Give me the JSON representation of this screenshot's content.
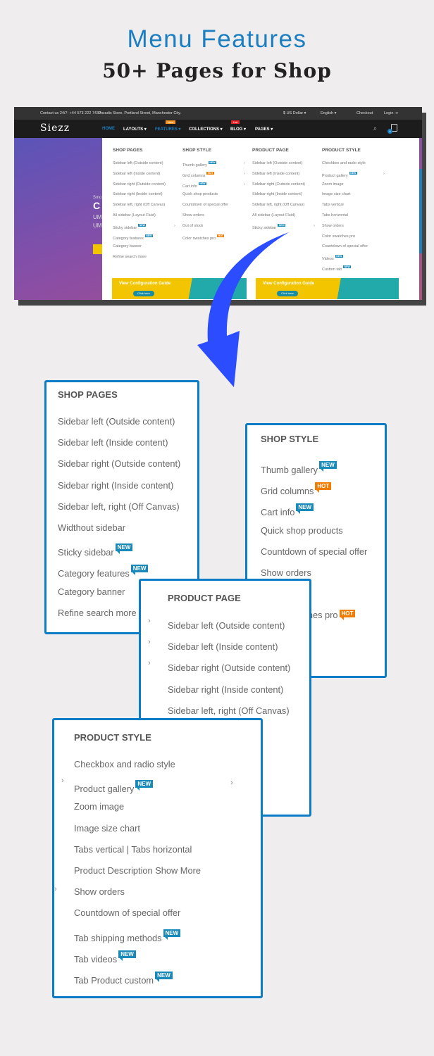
{
  "header": {
    "title": "Menu Features",
    "subtitle": "50+ Pages for Shop"
  },
  "screenshot": {
    "topbar": {
      "contact": "Contact us 24/7: +44 573 222 7439",
      "address": "Paradis Store, Portland Street, Manchester City.",
      "currency": "$ US Dollar ▾",
      "language": "English ▾",
      "checkout": "Checkout",
      "login": "Login ⇥"
    },
    "logo": "Siezz",
    "nav": [
      {
        "label": "HOME",
        "active": true
      },
      {
        "label": "LAYOUTS ▾"
      },
      {
        "label": "FEATURES ▾",
        "badge": "New",
        "active": true
      },
      {
        "label": "COLLECTIONS ▾"
      },
      {
        "label": "BLOG ▾",
        "badge": "Hot"
      },
      {
        "label": "PAGES ▾"
      }
    ],
    "cart_count": "0",
    "hero": {
      "small": "Smo",
      "big": "C",
      "line1": "UM",
      "line2": "UM"
    },
    "mega": {
      "columns": [
        {
          "title": "SHOP PAGES",
          "items": [
            {
              "t": "Sidebar left (Outside content)"
            },
            {
              "t": "Sidebar left (Inside content)"
            },
            {
              "t": "Sidebar right (Outside content)"
            },
            {
              "t": "Sidebar right (Inside content)"
            },
            {
              "t": "Sidebar left, right (Off Canvas)"
            },
            {
              "t": "All sidebar (Layout Fluid)"
            },
            {
              "t": "Sticky sidebar",
              "b": "NEW",
              "arrow": true
            },
            {
              "t": "Category features",
              "b": "NEW"
            },
            {
              "t": "Category banner"
            },
            {
              "t": "Refine search more"
            }
          ]
        },
        {
          "title": "SHOP STYLE",
          "items": [
            {
              "t": "Thumb gallery",
              "b": "NEW",
              "arrow": true
            },
            {
              "t": "Grid columns",
              "b": "HOT",
              "arrow": true
            },
            {
              "t": "Cart info",
              "b": "NEW",
              "arrow": true
            },
            {
              "t": "Quick shop products"
            },
            {
              "t": "Countdown of special offer"
            },
            {
              "t": "Show orders"
            },
            {
              "t": "Out of stock"
            },
            {
              "t": "Color swatches pro",
              "b": "HOT"
            }
          ]
        },
        {
          "title": "PRODUCT PAGE",
          "items": [
            {
              "t": "Sidebar left (Outside content)"
            },
            {
              "t": "Sidebar left (Inside content)"
            },
            {
              "t": "Sidebar right (Outside content)"
            },
            {
              "t": "Sidebar right (Inside content)"
            },
            {
              "t": "Sidebar left, right (Off Canvas)"
            },
            {
              "t": "All sidebar (Layout Fluid)"
            },
            {
              "t": "Sticky sidebar",
              "b": "NEW",
              "arrow": true
            }
          ]
        },
        {
          "title": "PRODUCT STYLE",
          "items": [
            {
              "t": "Checkbox and radio style"
            },
            {
              "t": "Product gallery",
              "b": "NEW",
              "arrow": true
            },
            {
              "t": "Zoom image"
            },
            {
              "t": "Image size chart"
            },
            {
              "t": "Tabs vertical"
            },
            {
              "t": "Tabs horizontal"
            },
            {
              "t": "Show orders"
            },
            {
              "t": "Color swatches pro"
            },
            {
              "t": "Countdown of special offer"
            },
            {
              "t": "Videos",
              "b": "NEW"
            },
            {
              "t": "Custom tab",
              "b": "NEW"
            }
          ]
        }
      ],
      "banners": [
        {
          "title": "View Configuration Guide",
          "button": "Click here"
        },
        {
          "title": "View Configuration Guide",
          "button": "Click here"
        }
      ]
    }
  },
  "cards": {
    "shop_pages": {
      "title": "SHOP PAGES",
      "items": [
        {
          "t": "Sidebar left (Outside content)"
        },
        {
          "t": "Sidebar left (Inside content)"
        },
        {
          "t": "Sidebar right (Outside content)"
        },
        {
          "t": "Sidebar right (Inside content)"
        },
        {
          "t": "Sidebar left, right (Off Canvas)"
        },
        {
          "t": "Widthout sidebar"
        },
        {
          "t": "Sticky sidebar",
          "b": "NEW"
        },
        {
          "t": "Category features",
          "b": "NEW"
        },
        {
          "t": "Category banner"
        },
        {
          "t": "Refine search more"
        }
      ]
    },
    "shop_style": {
      "title": "SHOP STYLE",
      "items": [
        {
          "t": "Thumb gallery",
          "b": "NEW"
        },
        {
          "t": "Grid columns",
          "b": "HOT"
        },
        {
          "t": "Cart info",
          "b": "NEW"
        },
        {
          "t": "Quick shop products"
        },
        {
          "t": "Countdown of special offer"
        },
        {
          "t": "Show orders"
        },
        {
          "t": ""
        },
        {
          "t": "Color swatches pro",
          "b": "HOT"
        }
      ]
    },
    "product_page": {
      "title": "PRODUCT PAGE",
      "items": [
        {
          "t": "Sidebar left (Outside content)"
        },
        {
          "t": "Sidebar left (Inside content)"
        },
        {
          "t": "Sidebar right (Outside content)"
        },
        {
          "t": "Sidebar right (Inside content)"
        },
        {
          "t": "Sidebar left, right (Off Canvas)"
        }
      ]
    },
    "product_style": {
      "title": "PRODUCT STYLE",
      "items": [
        {
          "t": "Checkbox and radio style"
        },
        {
          "t": "Product gallery",
          "b": "NEW"
        },
        {
          "t": "Zoom image"
        },
        {
          "t": "Image size chart"
        },
        {
          "t": "Tabs vertical | Tabs horizontal"
        },
        {
          "t": "Product Description Show More"
        },
        {
          "t": "Show orders"
        },
        {
          "t": "Countdown of special offer"
        },
        {
          "t": "Tab shipping methods",
          "b": "NEW"
        },
        {
          "t": "Tab videos",
          "b": "NEW"
        },
        {
          "t": "Tab Product custom",
          "b": "NEW"
        }
      ]
    }
  },
  "colors": {
    "accent": "#1a7fc1",
    "card_border": "#0d7cc6",
    "badge_new": "#1889b8",
    "badge_hot": "#f07c00",
    "arrow": "#2b4cff"
  }
}
